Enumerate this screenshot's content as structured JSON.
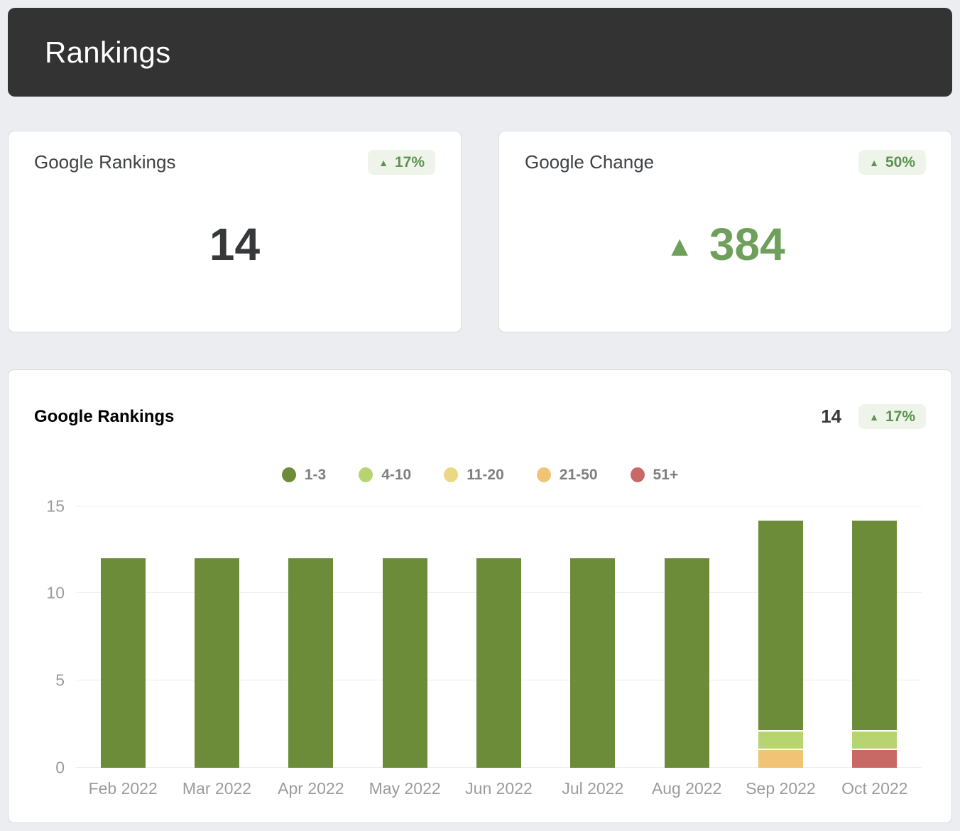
{
  "header": {
    "title": "Rankings"
  },
  "stat_cards": [
    {
      "title": "Google Rankings",
      "badge": {
        "arrow": "▲",
        "value": "17%"
      },
      "value": "14"
    },
    {
      "title": "Google Change",
      "badge": {
        "arrow": "▲",
        "value": "50%"
      },
      "value_arrow": "▲",
      "value": "384"
    }
  ],
  "chart_card": {
    "title": "Google Rankings",
    "summary_value": "14",
    "badge": {
      "arrow": "▲",
      "value": "17%"
    }
  },
  "chart_data": {
    "type": "bar",
    "stacked": true,
    "title": "Google Rankings",
    "categories": [
      "Feb 2022",
      "Mar 2022",
      "Apr 2022",
      "May 2022",
      "Jun 2022",
      "Jul 2022",
      "Aug 2022",
      "Sep 2022",
      "Oct 2022"
    ],
    "series": [
      {
        "name": "1-3",
        "color": "#6d8c3a",
        "values": [
          12,
          12,
          12,
          12,
          12,
          12,
          12,
          12,
          12
        ]
      },
      {
        "name": "4-10",
        "color": "#b8d470",
        "values": [
          0,
          0,
          0,
          0,
          0,
          0,
          0,
          1,
          1
        ]
      },
      {
        "name": "11-20",
        "color": "#ecd784",
        "values": [
          0,
          0,
          0,
          0,
          0,
          0,
          0,
          0,
          0
        ]
      },
      {
        "name": "21-50",
        "color": "#f0c474",
        "values": [
          0,
          0,
          0,
          0,
          0,
          0,
          0,
          1,
          0
        ]
      },
      {
        "name": "51+",
        "color": "#c96966",
        "values": [
          0,
          0,
          0,
          0,
          0,
          0,
          0,
          0,
          1
        ]
      }
    ],
    "xlabel": "",
    "ylabel": "",
    "ylim": [
      0,
      15
    ],
    "yticks": [
      0,
      5,
      10,
      15
    ],
    "legend_position": "top",
    "grid": true
  },
  "colors": {
    "header_bg": "#333333",
    "page_bg": "#ebedf0",
    "accent_green": "#6ea05b",
    "badge_bg": "#eef4e9",
    "badge_text": "#5d9350",
    "grid_line": "#ededed",
    "axis_text": "#9b9b9b"
  }
}
